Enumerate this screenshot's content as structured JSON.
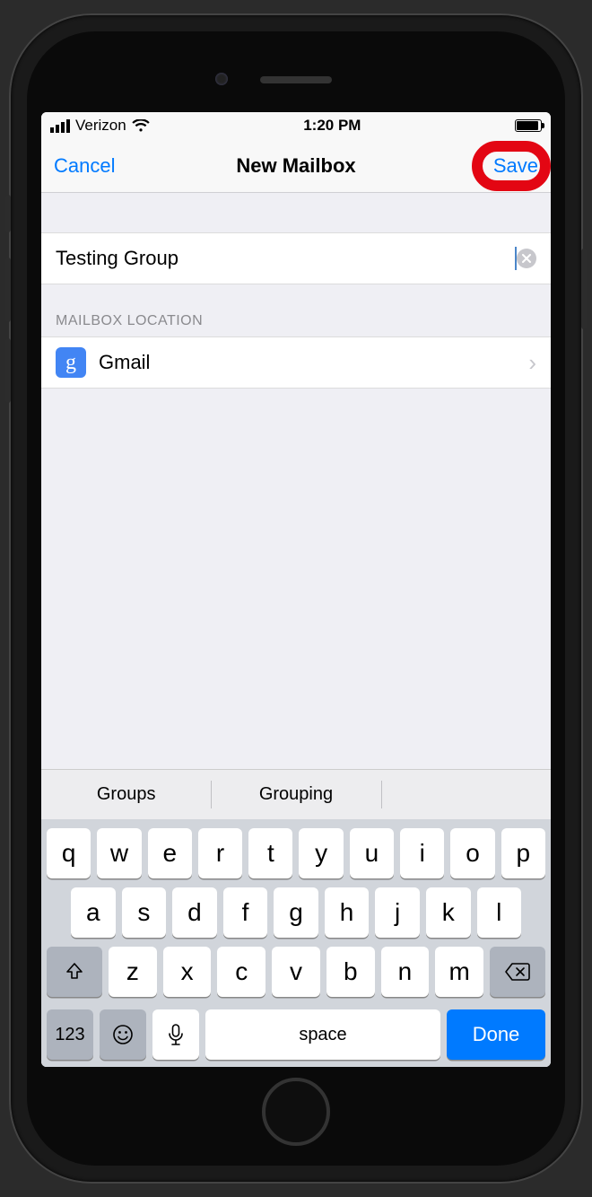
{
  "statusbar": {
    "carrier": "Verizon",
    "time": "1:20 PM"
  },
  "nav": {
    "cancel": "Cancel",
    "title": "New Mailbox",
    "save": "Save"
  },
  "form": {
    "name_value": "Testing Group",
    "section_header": "MAILBOX LOCATION",
    "location_label": "Gmail",
    "gmail_icon_glyph": "g"
  },
  "keyboard": {
    "suggestions": [
      "Groups",
      "Grouping",
      ""
    ],
    "row1": [
      "q",
      "w",
      "e",
      "r",
      "t",
      "y",
      "u",
      "i",
      "o",
      "p"
    ],
    "row2": [
      "a",
      "s",
      "d",
      "f",
      "g",
      "h",
      "j",
      "k",
      "l"
    ],
    "row3": [
      "z",
      "x",
      "c",
      "v",
      "b",
      "n",
      "m"
    ],
    "fn_label": "123",
    "space_label": "space",
    "done_label": "Done"
  }
}
